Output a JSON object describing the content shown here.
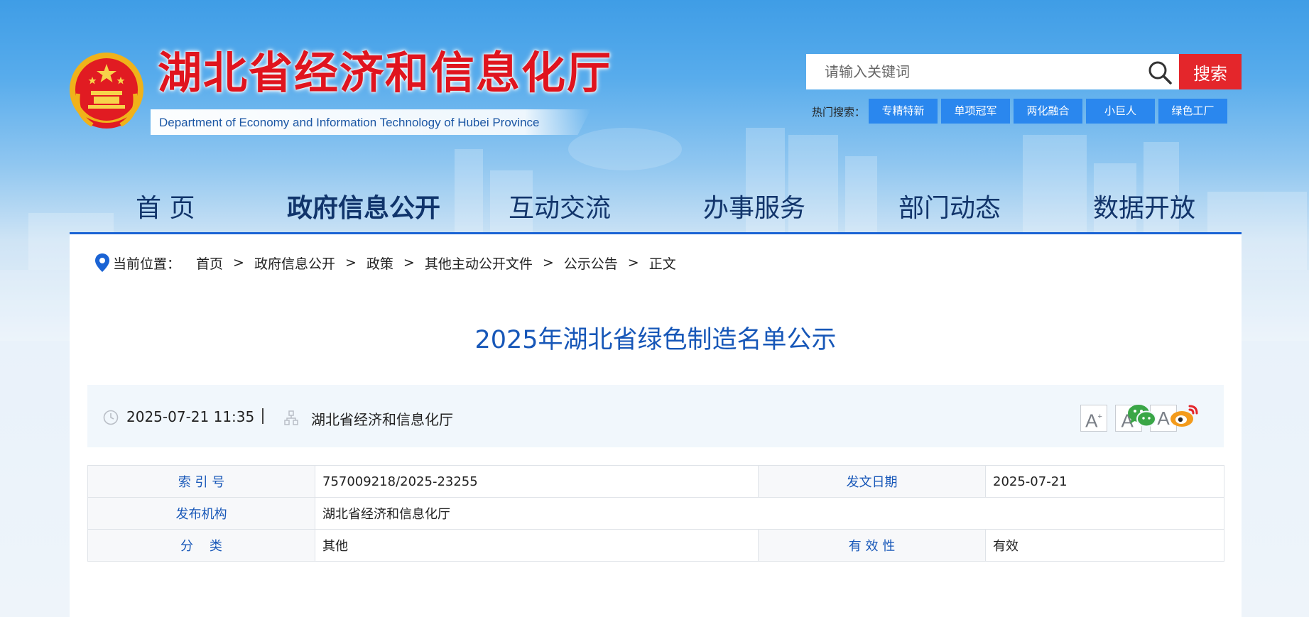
{
  "header": {
    "site_title": "湖北省经济和信息化厅",
    "site_subtitle": "Department of Economy and Information Technology of Hubei Province"
  },
  "search": {
    "placeholder": "请输入关键词",
    "button_label": "搜索",
    "hot_label": "热门搜索：",
    "hot_tags": [
      "专精特新",
      "单项冠军",
      "两化融合",
      "小巨人",
      "绿色工厂"
    ]
  },
  "nav": {
    "items": [
      {
        "label": "首  页"
      },
      {
        "label": "政府信息公开"
      },
      {
        "label": "互动交流"
      },
      {
        "label": "办事服务"
      },
      {
        "label": "部门动态"
      },
      {
        "label": "数据开放"
      }
    ]
  },
  "breadcrumb": {
    "label": "当前位置：",
    "separator": ">",
    "items": [
      "首页",
      "政府信息公开",
      "政策",
      "其他主动公开文件",
      "公示公告",
      "正文"
    ]
  },
  "article": {
    "title": "2025年湖北省绿色制造名单公示",
    "date": "2025-07-21 11:35",
    "source": "湖北省经济和信息化厅",
    "font_sizes": [
      "A",
      "A",
      "A"
    ]
  },
  "meta": {
    "index_no_label": "索 引 号",
    "index_no": "757009218/2025-23255",
    "issue_date_label": "发文日期",
    "issue_date": "2025-07-21",
    "publisher_label": "发布机构",
    "publisher": "湖北省经济和信息化厅",
    "category_label": "分    类",
    "category": "其他",
    "validity_label": "有 效 性",
    "validity": "有效"
  },
  "colors": {
    "title_red": "#e0141e",
    "search_red": "#e4262b",
    "tag_blue": "#2a87ee",
    "link_blue": "#1757b8",
    "nav_line": "#1a63d4"
  }
}
